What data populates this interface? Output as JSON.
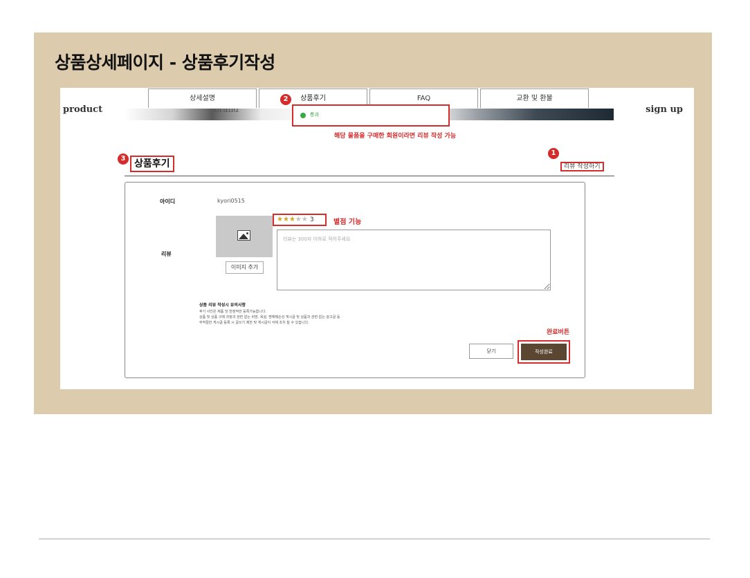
{
  "slide": {
    "title": "상품상세페이지 - 상품후기작성"
  },
  "site": {
    "brand_left": "product",
    "brand_right": "sign up",
    "hero_text": "brand"
  },
  "tabs": [
    {
      "label": "상세설명"
    },
    {
      "label": "상품후기"
    },
    {
      "label": "FAQ"
    },
    {
      "label": "교환 및 환불"
    }
  ],
  "markers": {
    "one": "1",
    "two": "2",
    "three": "3"
  },
  "toast": {
    "text": "통과"
  },
  "notes": {
    "purchase_only": "해당 물품을 구매한 회원이라면 리뷰 작성 가능",
    "rating": "별점 기능",
    "complete_button": "완료버튼"
  },
  "review_section": {
    "heading": "상품후기",
    "write_link": "리뷰 작성하기"
  },
  "form": {
    "id_label": "아이디",
    "id_value": "kyori0515",
    "review_label": "리뷰",
    "add_image": "이미지 추가",
    "rating": {
      "value": 3,
      "max": 5,
      "display": "3"
    },
    "textarea_placeholder": "리뷰는 300자 이하로 적어주세요",
    "caution_title": "상품 리뷰 작성시 유의사항",
    "caution_lines": [
      "후기 사진은 제품 당 한정적만 등록가능합니다.",
      "상품 및 상품 구매 과정과 관련 없는 비방, 욕설, 명예훼손성 게시글 및 상품과 관련 없는 광고글 등",
      "부적절한 게시글 등록 시 글쓰기 제한 및 게시글이 삭제 조치 될 수 있습니다."
    ],
    "close_label": "닫기",
    "submit_label": "작성완료"
  },
  "colors": {
    "panel_bg": "#dccbad",
    "accent_red": "#d42b2b",
    "submit_bg": "#5b4632",
    "success_green": "#3aa845",
    "star_gold": "#d9a520"
  },
  "icons": {
    "toast": "check-circle-icon",
    "image": "image-placeholder-icon",
    "star": "star-icon"
  }
}
